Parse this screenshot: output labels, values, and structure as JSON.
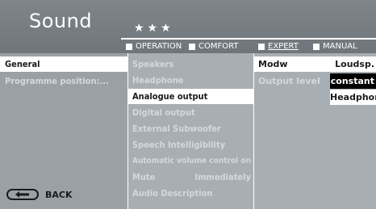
{
  "header": {
    "title": "Sound",
    "stars": "★★★",
    "modes": [
      {
        "label": "OPERATION"
      },
      {
        "label": "COMFORT"
      },
      {
        "label": "EXPERT"
      },
      {
        "label": "MANUAL"
      }
    ],
    "active_mode": "EXPERT"
  },
  "left_menu": {
    "items": [
      {
        "label": "General"
      },
      {
        "label": "Programme position:..."
      }
    ]
  },
  "middle_menu": {
    "items": [
      {
        "label": "Speakers"
      },
      {
        "label": "Headphone"
      },
      {
        "label": "Analogue output"
      },
      {
        "label": "Digital output"
      },
      {
        "label": "External Subwoofer"
      },
      {
        "label": "Speech Intelligibility"
      },
      {
        "label": "Automatic volume control",
        "value": "on"
      },
      {
        "label": "Mute",
        "value": "Immediately"
      },
      {
        "label": "Audio Description"
      }
    ]
  },
  "right_panel": {
    "header_key": "Modw",
    "header_value": "Loudsp.",
    "output_level_label": "Output level",
    "options": [
      "constant",
      "Headphone"
    ]
  },
  "footer": {
    "back_label": "BACK"
  },
  "colors": {
    "background": "#9aa1a6",
    "header": "#767d82",
    "selected": "#ffffff",
    "active_option": "#000000"
  }
}
